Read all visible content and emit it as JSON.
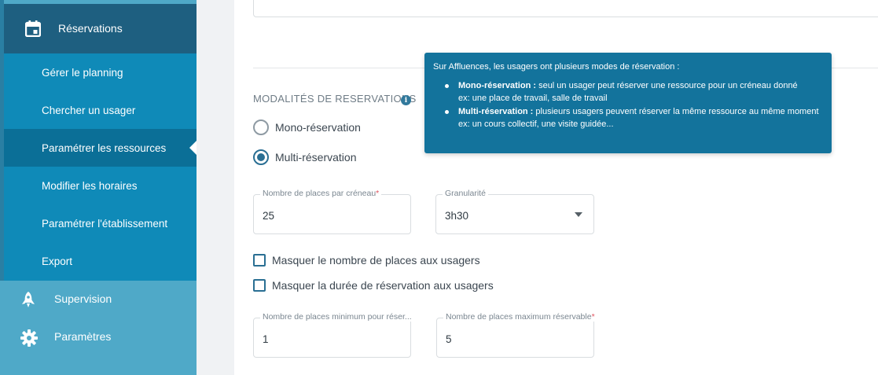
{
  "sidebar": {
    "reservations_label": "Réservations",
    "submenu": [
      {
        "label": "Gérer le planning"
      },
      {
        "label": "Chercher un usager"
      },
      {
        "label": "Paramétrer les ressources"
      },
      {
        "label": "Modifier les horaires"
      },
      {
        "label": "Paramétrer l'établissement"
      },
      {
        "label": "Export"
      }
    ],
    "active_index": 2,
    "supervision_label": "Supervision",
    "parametres_label": "Paramètres",
    "icons": {
      "reservations": "calendar-icon",
      "supervision": "rocket-icon",
      "parametres": "gear-icon"
    }
  },
  "section": {
    "title": "MODALITÉS DE RESERVATIONS",
    "info_icon": "info-icon"
  },
  "radios": {
    "mono_label": "Mono-réservation",
    "multi_label": "Multi-réservation",
    "selected": "multi"
  },
  "fields": {
    "places_label": "Nombre de places par créneau",
    "places_value": "25",
    "granularite_label": "Granularité",
    "granularite_value": "3h30",
    "min_label": "Nombre de places minimum pour réser...",
    "min_value": "1",
    "max_label": "Nombre de places maximum réservable",
    "max_value": "5",
    "required_mark": "*"
  },
  "checkboxes": {
    "hide_places": "Masquer le nombre de places aux usagers",
    "hide_duration": "Masquer la durée de réservation aux usagers"
  },
  "tooltip": {
    "intro": "Sur Affluences, les usagers ont plusieurs modes de réservation :",
    "mono_title": "Mono-réservation :",
    "mono_text": " seul un usager peut réserver une ressource pour un créneau donné",
    "mono_example": "ex: une place de travail, salle de travail",
    "multi_title": "Multi-réservation :",
    "multi_text": " plusieurs usagers peuvent réserver la même ressource au même moment",
    "multi_example": "ex: un cours collectif, une visite guidée..."
  },
  "colors": {
    "sidebar_dark": "#1e5f80",
    "submenu": "#0f8ab8",
    "submenu_active": "#0b6f97",
    "sidebar_light": "#4fa9c8",
    "tooltip": "#13739c",
    "accent": "#2a6f93"
  }
}
